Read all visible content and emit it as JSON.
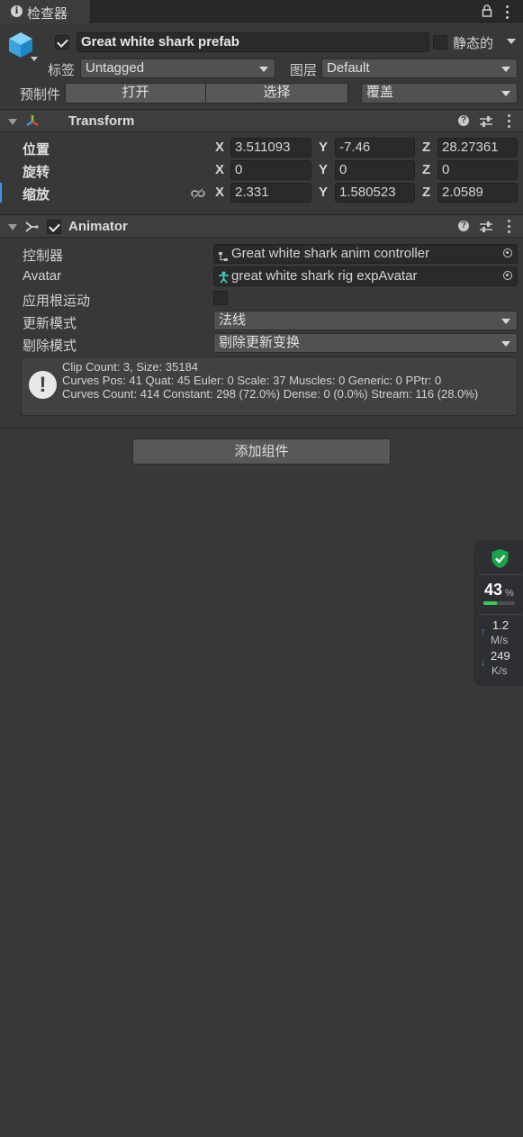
{
  "tab": {
    "title": "检查器"
  },
  "object": {
    "name": "Great white shark prefab",
    "active": true,
    "static_label": "静态的",
    "static": false,
    "tag_label": "标签",
    "tag_value": "Untagged",
    "layer_label": "图层",
    "layer_value": "Default"
  },
  "prefab": {
    "label": "预制件",
    "open": "打开",
    "select": "选择",
    "overrides": "覆盖"
  },
  "transform": {
    "title": "Transform",
    "rows": [
      {
        "label": "位置",
        "x": "3.511093",
        "y": "-7.46",
        "z": "28.27361"
      },
      {
        "label": "旋转",
        "x": "0",
        "y": "0",
        "z": "0"
      },
      {
        "label": "缩放",
        "x": "2.331",
        "y": "1.580523",
        "z": "2.0589"
      }
    ],
    "axis": {
      "x": "X",
      "y": "Y",
      "z": "Z"
    }
  },
  "animator": {
    "title": "Animator",
    "enabled": true,
    "controller_label": "控制器",
    "controller_value": "Great white shark anim controller",
    "avatar_label": "Avatar",
    "avatar_value": "great white shark rig expAvatar",
    "root_motion_label": "应用根运动",
    "root_motion": false,
    "update_mode_label": "更新模式",
    "update_mode_value": "法线",
    "culling_label": "剔除模式",
    "culling_value": "剔除更新变换",
    "info_lines": [
      "Clip Count: 3, Size: 35184",
      "Curves Pos: 41 Quat: 45 Euler: 0 Scale: 37 Muscles: 0 Generic: 0 PPtr: 0",
      "Curves Count: 414 Constant: 298 (72.0%) Dense: 0 (0.0%) Stream: 116 (28.0%)"
    ]
  },
  "add_component": "添加组件",
  "monitor": {
    "percent": "43",
    "percent_unit": "%",
    "fill": 0.43,
    "upload": "1.2",
    "upload_unit": "M/s",
    "download": "249",
    "download_unit": "K/s",
    "colors": {
      "shield": "#1aa34a",
      "bar": "#3ec45a"
    }
  }
}
